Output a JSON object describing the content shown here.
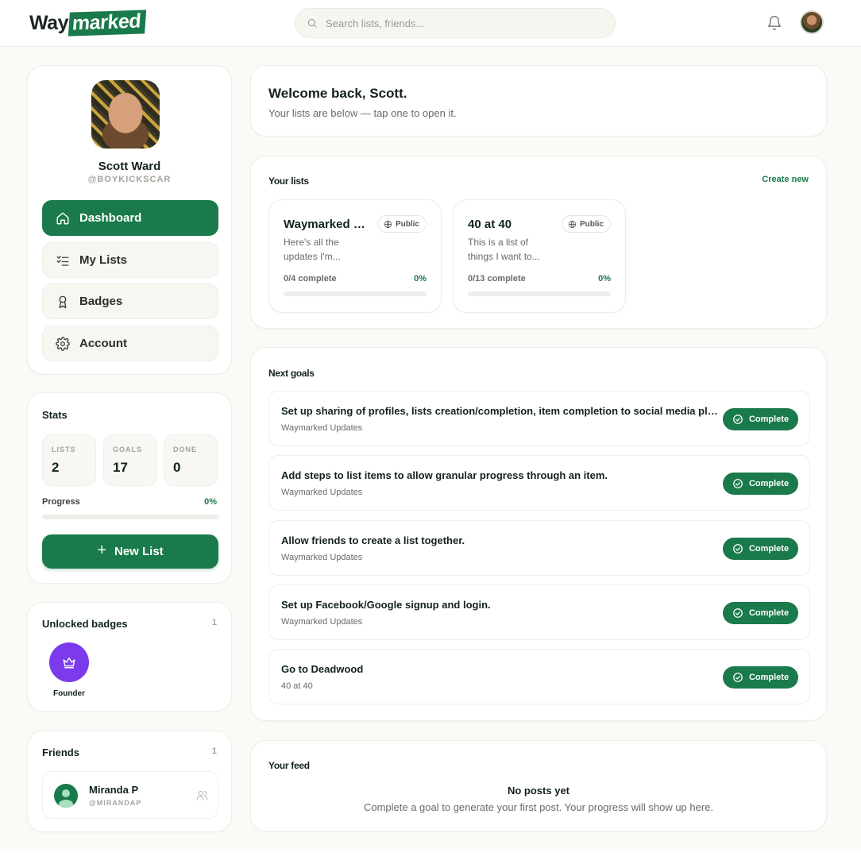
{
  "brand": {
    "name_part1": "Way",
    "name_part2": "marked",
    "accent": "#1a7a4b"
  },
  "search": {
    "placeholder": "Search lists, friends..."
  },
  "header": {
    "notification_icon": "bell-icon",
    "avatar_icon": "user-avatar"
  },
  "profile": {
    "name": "Scott Ward",
    "handle": "@BOYKICKSCAR"
  },
  "sidebar": {
    "items": [
      {
        "label": "Dashboard",
        "icon": "home-icon",
        "active": true
      },
      {
        "label": "My Lists",
        "icon": "checklist-icon",
        "active": false
      },
      {
        "label": "Badges",
        "icon": "award-icon",
        "active": false
      },
      {
        "label": "Account",
        "icon": "gear-icon",
        "active": false
      }
    ]
  },
  "stats": {
    "title": "Stats",
    "lists_label": "LISTS",
    "lists_value": "2",
    "goals_label": "GOALS",
    "goals_value": "17",
    "done_label": "DONE",
    "done_value": "0",
    "progress_label": "Progress",
    "progress_value": "0%",
    "progress_fraction": 0,
    "new_list_label": "New List"
  },
  "badges": {
    "title": "Unlocked badges",
    "count": "1",
    "items": [
      {
        "name": "Founder",
        "icon": "crown-icon",
        "color": "#7c3aed"
      }
    ]
  },
  "friends": {
    "title": "Friends",
    "count": "1",
    "items": [
      {
        "name": "Miranda P",
        "handle": "@MIRANDAP"
      }
    ]
  },
  "welcome": {
    "title": "Welcome back, Scott.",
    "subtitle": "Your lists are below — tap one to open it."
  },
  "your_lists": {
    "title": "Your lists",
    "create_new": "Create new",
    "items": [
      {
        "title": "Waymarked Updates",
        "visibility": "Public",
        "description": "Here's all the updates I'm...",
        "complete": "0/4 complete",
        "percent": "0%",
        "fraction": 0
      },
      {
        "title": "40 at 40",
        "visibility": "Public",
        "description": "This is a list of things I want to...",
        "complete": "0/13 complete",
        "percent": "0%",
        "fraction": 0
      }
    ]
  },
  "next_goals": {
    "title": "Next goals",
    "complete_label": "Complete",
    "items": [
      {
        "title": "Set up sharing of profiles, lists creation/completion, item completion to social media platforms.",
        "list": "Waymarked Updates"
      },
      {
        "title": "Add steps to list items to allow granular progress through an item.",
        "list": "Waymarked Updates"
      },
      {
        "title": "Allow friends to create a list together.",
        "list": "Waymarked Updates"
      },
      {
        "title": "Set up Facebook/Google signup and login.",
        "list": "Waymarked Updates"
      },
      {
        "title": "Go to Deadwood",
        "list": "40 at 40"
      }
    ]
  },
  "feed": {
    "title": "Your feed",
    "empty_title": "No posts yet",
    "empty_subtitle": "Complete a goal to generate your first post. Your progress will show up here."
  }
}
